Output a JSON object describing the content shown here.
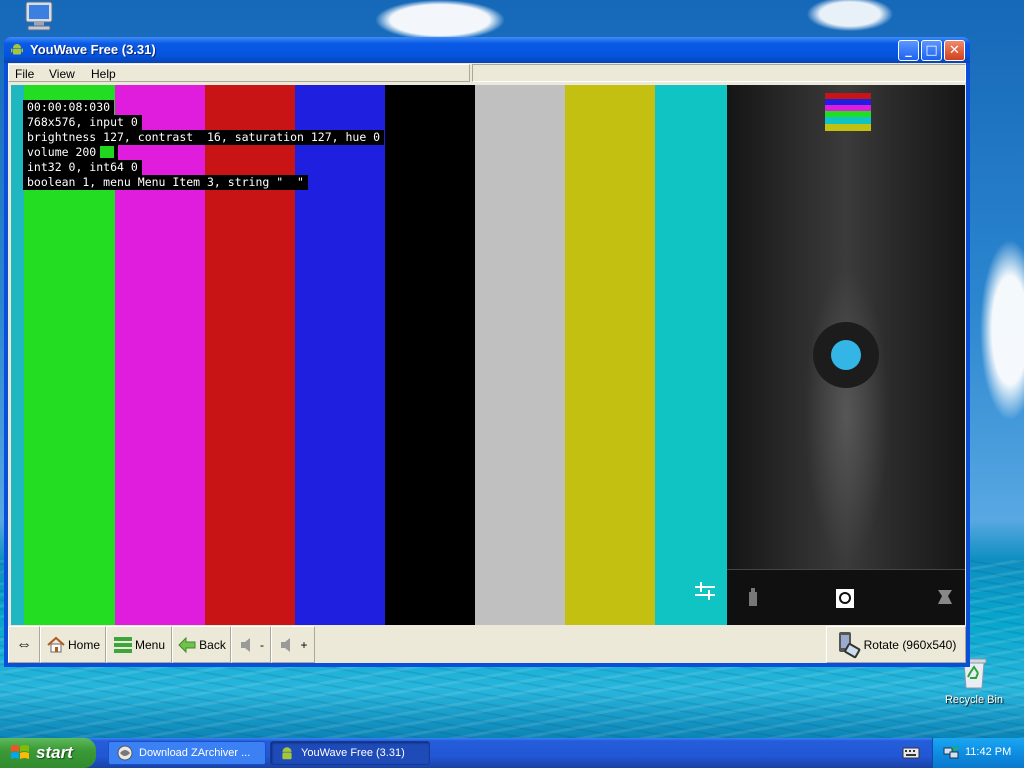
{
  "window": {
    "title": "YouWave Free (3.31)",
    "controls": {
      "minimize": "_",
      "maximize": "□",
      "close": "✕"
    }
  },
  "menu": {
    "file": "File",
    "view": "View",
    "help": "Help"
  },
  "screen": {
    "overlay": {
      "timecode": "00:00:08:030",
      "resolution": "768x576, input 0",
      "picture": "brightness 127, contrast  16, saturation 127, hue 0",
      "volume": "volume 200",
      "ints": "int32 0, int64 0",
      "misc": "boolean 1, menu Menu Item 3, string \"  \""
    },
    "color_bars": [
      "#20b8c0",
      "#22dd22",
      "#e01ddd",
      "#c81414",
      "#1f1fe0",
      "#000000",
      "#c0c0c0",
      "#c4c012",
      "#11c4c4"
    ],
    "camera_panel_icons": [
      "camera-switch-icon",
      "shutter-button",
      "mode-icon",
      "torch-icon",
      "settings-sliders-icon"
    ]
  },
  "toolbar": {
    "arrows_label": "⇔",
    "home": "Home",
    "menu": "Menu",
    "back": "Back",
    "vol_down": "-",
    "vol_up": "+",
    "rotate": "Rotate (960x540)"
  },
  "desktop": {
    "recycle_bin": "Recycle Bin"
  },
  "taskbar": {
    "start": "start",
    "tasks": [
      "Download ZArchiver ...",
      "YouWave Free (3.31)"
    ],
    "clock": "11:42 PM"
  }
}
